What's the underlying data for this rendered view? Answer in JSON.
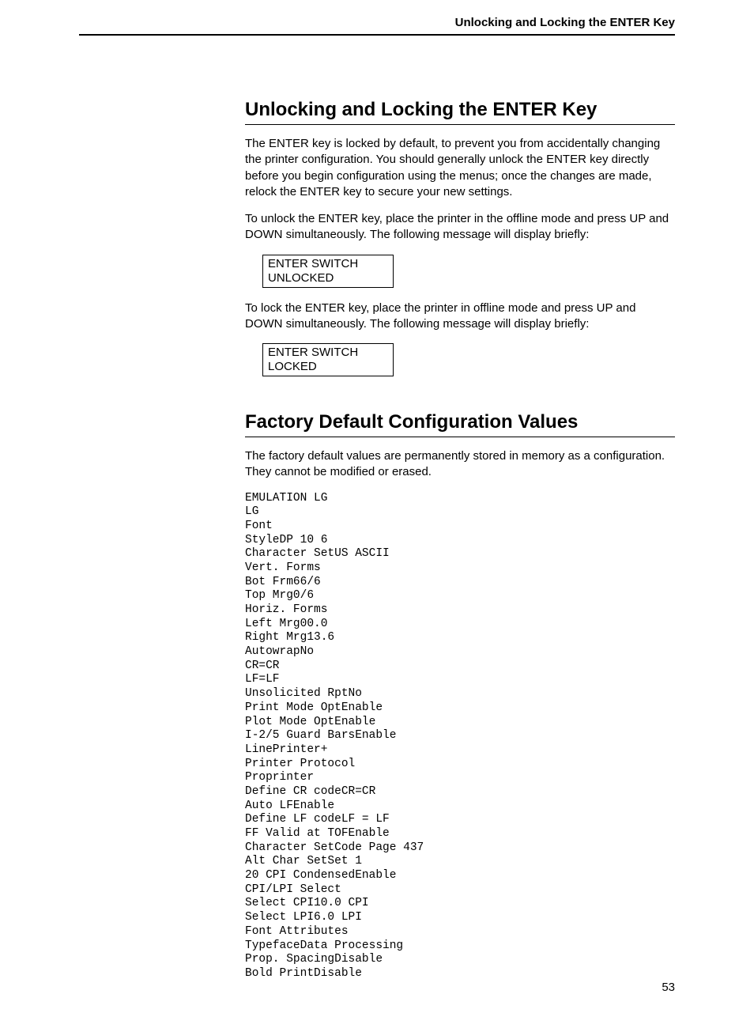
{
  "running_head": "Unlocking and Locking the ENTER Key",
  "section1": {
    "title": "Unlocking and Locking the ENTER Key",
    "para1": "The ENTER key is locked by default, to prevent you from accidentally changing the printer configuration. You should generally unlock the ENTER key directly before you begin configuration using the menus; once the changes are made, relock the ENTER key to secure your new settings.",
    "para2": "To unlock the ENTER key, place the printer in the offline mode and press UP and DOWN simultaneously. The following message will display briefly:",
    "box1_line1": "ENTER SWITCH",
    "box1_line2": "UNLOCKED",
    "para3": "To lock the ENTER key, place the printer in offline mode and press UP and DOWN simultaneously. The following message will display briefly:",
    "box2_line1": "ENTER SWITCH",
    "box2_line2": "LOCKED"
  },
  "section2": {
    "title": "Factory Default Configuration Values",
    "para1": "The factory default values are permanently stored in memory as a configuration. They cannot be modified or erased.",
    "mono": "EMULATION LG\nLG\nFont\nStyleDP 10 6\nCharacter SetUS ASCII\nVert. Forms\nBot Frm66/6\nTop Mrg0/6\nHoriz. Forms\nLeft Mrg00.0\nRight Mrg13.6\nAutowrapNo\nCR=CR\nLF=LF\nUnsolicited RptNo\nPrint Mode OptEnable\nPlot Mode OptEnable\nI-2/5 Guard BarsEnable\nLinePrinter+\nPrinter Protocol\nProprinter\nDefine CR codeCR=CR\nAuto LFEnable\nDefine LF codeLF = LF\nFF Valid at TOFEnable\nCharacter SetCode Page 437\nAlt Char SetSet 1\n20 CPI CondensedEnable\nCPI/LPI Select\nSelect CPI10.0 CPI\nSelect LPI6.0 LPI\nFont Attributes\nTypefaceData Processing\nProp. SpacingDisable\nBold PrintDisable"
  },
  "page_number": "53"
}
